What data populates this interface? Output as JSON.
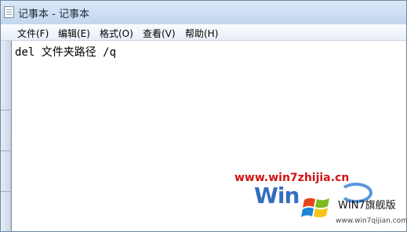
{
  "window": {
    "title": "记事本 - 记事本"
  },
  "menu": {
    "items": [
      {
        "label": "文件(F)"
      },
      {
        "label": "编辑(E)"
      },
      {
        "label": "格式(O)"
      },
      {
        "label": "查看(V)"
      },
      {
        "label": "帮助(H)"
      }
    ]
  },
  "editor": {
    "content": "del 文件夹路径 /q"
  },
  "watermark": {
    "site": "www.win7zhijia.cn",
    "logo": "Win",
    "brand": "WIN7旗舰版",
    "url": "www.win7qijian.com"
  },
  "colors": {
    "watermark_red": "#d01414",
    "logo_blue": "#1f5fb8"
  }
}
